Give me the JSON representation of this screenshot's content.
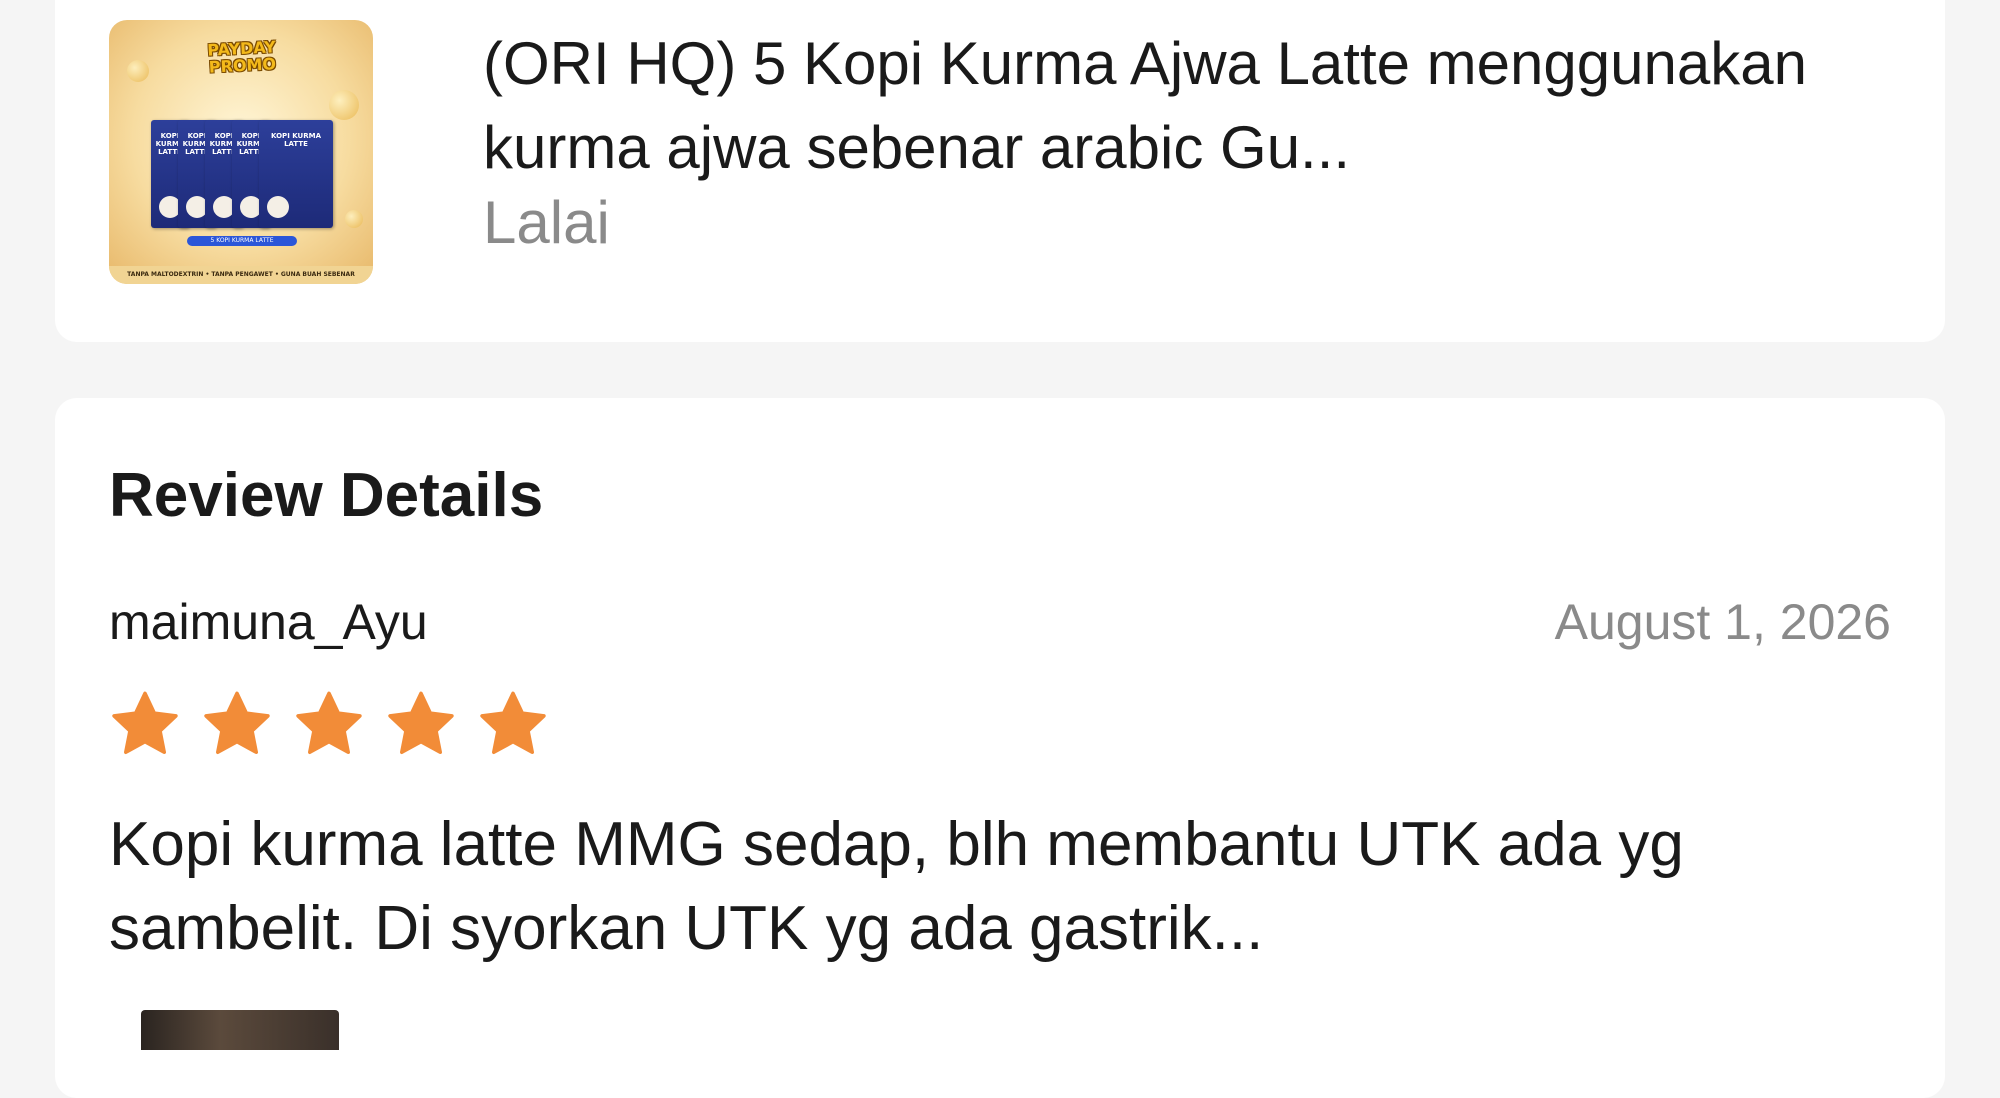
{
  "product": {
    "title": "(ORI HQ) 5 Kopi Kurma Ajwa Latte menggunakan kurma ajwa sebenar arabic Gu...",
    "variant": "Lalai",
    "thumbnail": {
      "promo_text": "PAYDAY PROMO",
      "pack_label": "KOPI KURMA LATTE",
      "ribbon_text": "5 KOPI KURMA LATTE",
      "footer_text": "TANPA MALTODEXTRIN • TANPA PENGAWET • GUNA BUAH SEBENAR"
    }
  },
  "review_details": {
    "section_title": "Review Details",
    "reviewer": "maimuna_Ayu",
    "date": "August 1, 2026",
    "rating": 5,
    "rating_max": 5,
    "star_color": "#F28C38",
    "text": "Kopi kurma latte MMG sedap, blh membantu UTK ada yg sambelit. Di syorkan UTK yg ada gastrik..."
  },
  "colors": {
    "background": "#f5f5f5",
    "card": "#ffffff",
    "primary_text": "#1a1a1a",
    "secondary_text": "#8a8a8a"
  }
}
